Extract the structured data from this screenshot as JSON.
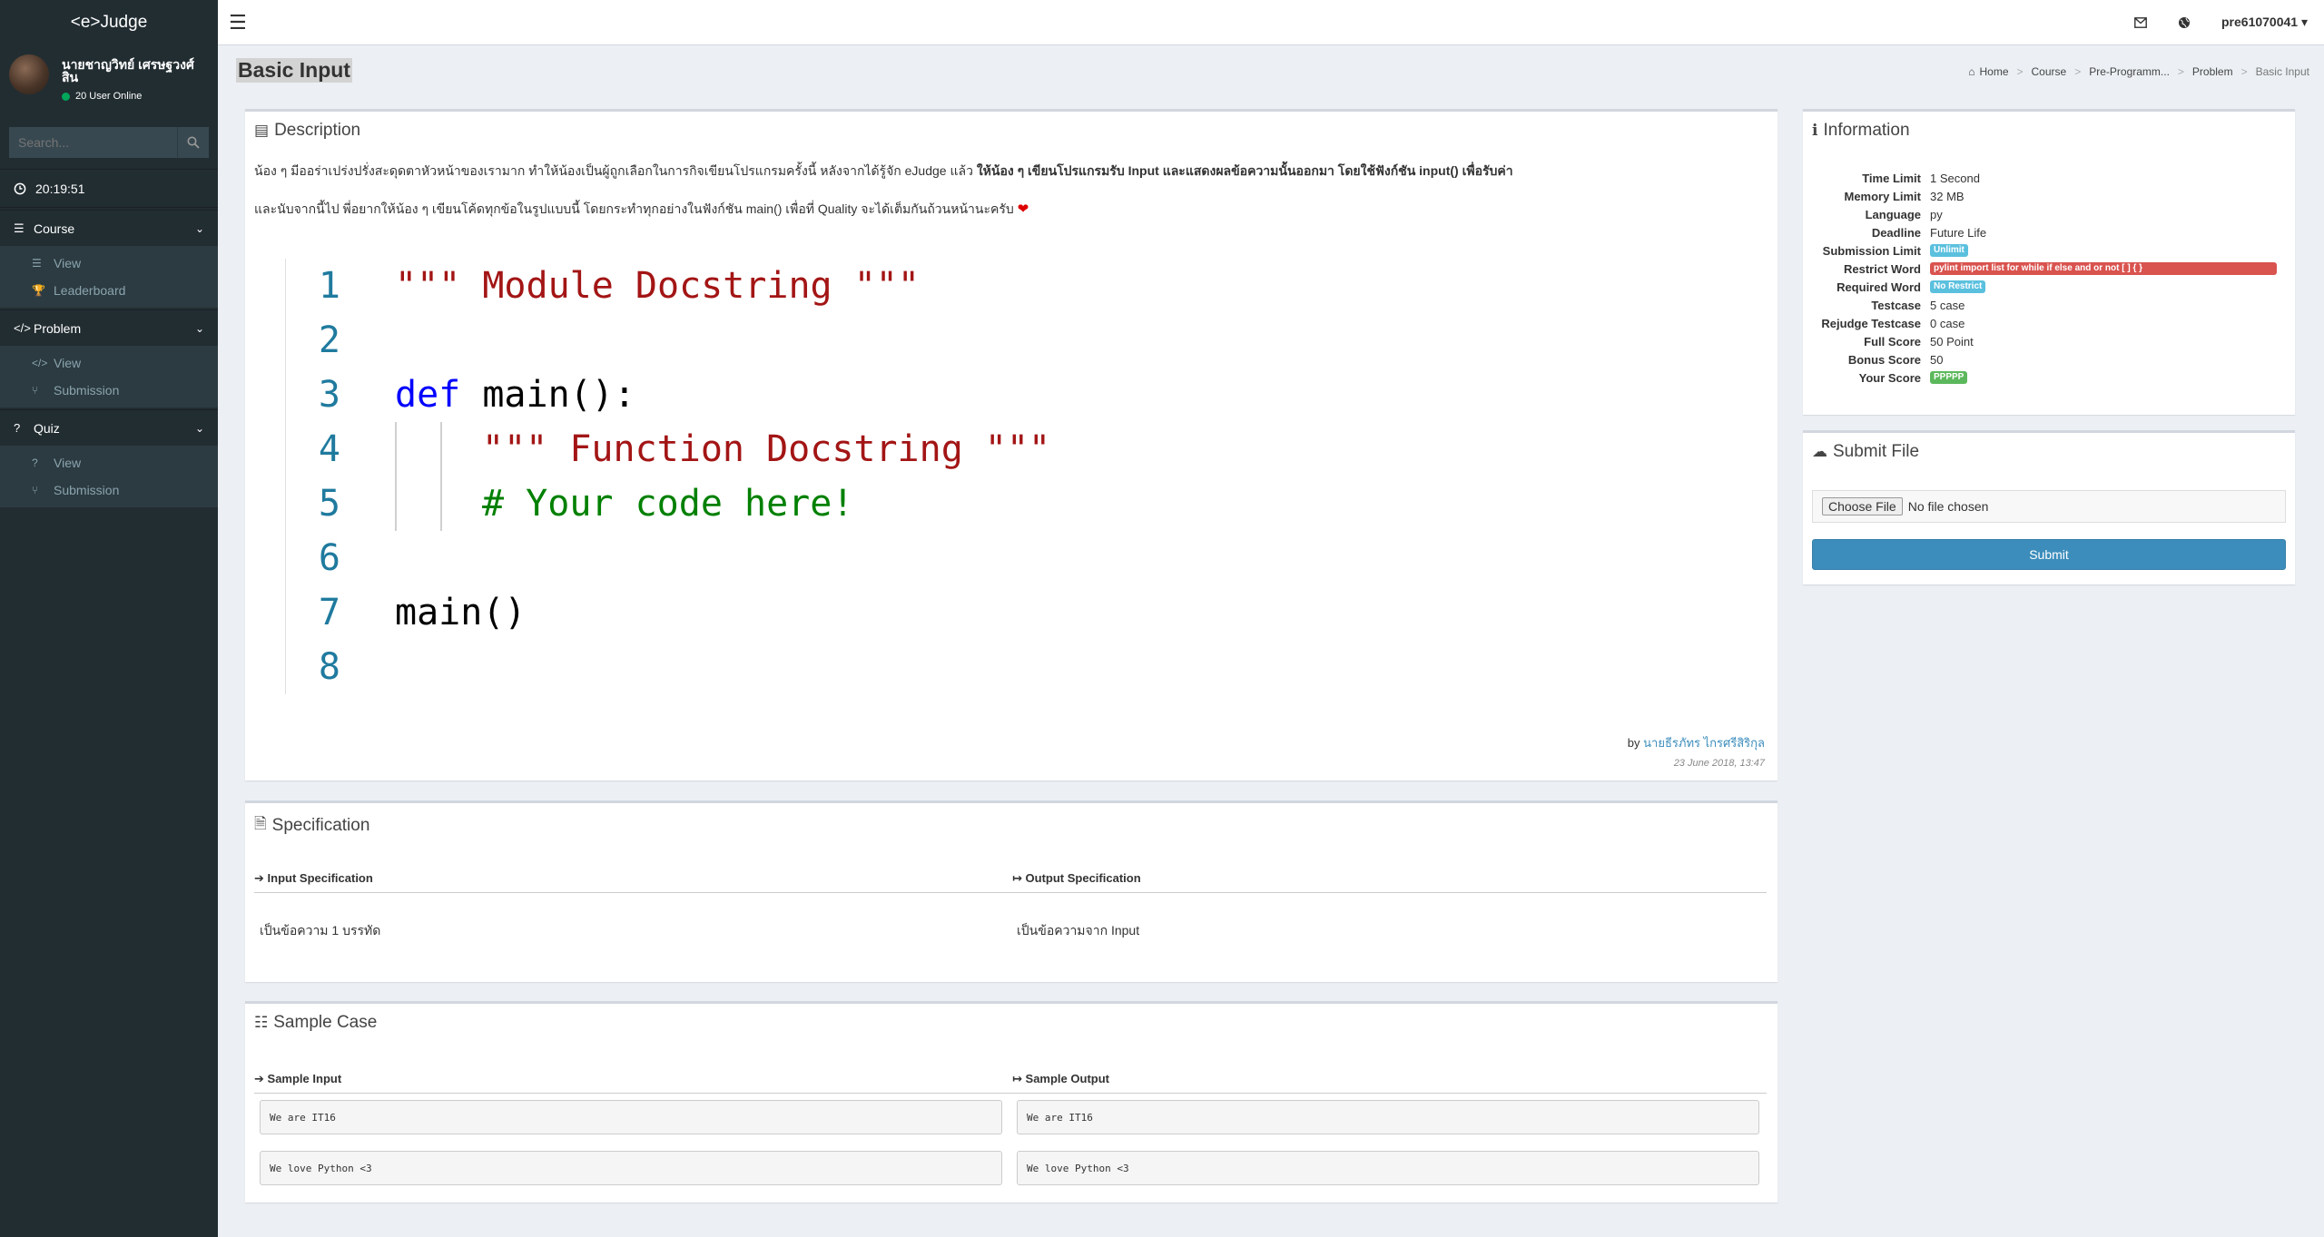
{
  "app": {
    "logo": "<e>Judge"
  },
  "user": {
    "name": "นายชาญวิทย์ เศรษฐวงศ์สิน",
    "online": "20 User Online"
  },
  "search": {
    "placeholder": "Search..."
  },
  "clock": "20:19:51",
  "sidebar": {
    "sections": [
      {
        "label": "Course",
        "icon": "list-icon",
        "items": [
          {
            "label": "View",
            "icon": "list-icon"
          },
          {
            "label": "Leaderboard",
            "icon": "trophy-icon"
          }
        ]
      },
      {
        "label": "Problem",
        "icon": "code-icon",
        "items": [
          {
            "label": "View",
            "icon": "code-icon"
          },
          {
            "label": "Submission",
            "icon": "branch-icon"
          }
        ]
      },
      {
        "label": "Quiz",
        "icon": "question-icon",
        "items": [
          {
            "label": "View",
            "icon": "question-icon"
          },
          {
            "label": "Submission",
            "icon": "branch-icon"
          }
        ]
      }
    ]
  },
  "topbar": {
    "username": "pre61070041"
  },
  "page": {
    "title": "Basic Input"
  },
  "breadcrumb": [
    "Home",
    "Course",
    "Pre-Programm...",
    "Problem",
    "Basic Input"
  ],
  "description": {
    "title": "Description",
    "line1_normal": "น้อง ๆ มีออร่าเปร่งปรั่งสะดุดตาหัวหน้าของเรามาก ทำให้น้องเป็นผู้ถูกเลือกในการกิจเขียนโปรแกรมครั้งนี้ หลังจากได้รู้จัก eJudge แล้ว ",
    "line1_bold": "ให้น้อง ๆ เขียนโปรแกรมรับ Input และแสดงผลข้อความนั้นออกมา โดยใช้ฟังก์ชัน input() เพื่อรับค่า",
    "line2": "และนับจากนี้ไป พี่อยากให้น้อง ๆ เขียนโค้ดทุกข้อในรูปแบบนี้ โดยกระทำทุกอย่างในฟังก์ชัน main() เพื่อที่ Quality จะได้เต็มกันถ้วนหน้านะครับ",
    "code": {
      "line_numbers": [
        "1",
        "2",
        "3",
        "4",
        "5",
        "6",
        "7",
        "8"
      ],
      "l1": "\"\"\" Module Docstring \"\"\"",
      "l3_kw": "def",
      "l3_rest": " main():",
      "l4": "\"\"\" Function Docstring \"\"\"",
      "l5": "# Your code here!",
      "l7": "main()"
    },
    "by_prefix": "by",
    "author": "นายธีรภัทร ไกรศรีสิริกุล",
    "date": "23 June 2018, 13:47"
  },
  "specification": {
    "title": "Specification",
    "input_title": "Input Specification",
    "output_title": "Output Specification",
    "input_value": "เป็นข้อความ 1 บรรทัด",
    "output_value": "เป็นข้อความจาก Input"
  },
  "sample": {
    "title": "Sample Case",
    "input_title": "Sample Input",
    "output_title": "Sample Output",
    "inputs": [
      "We are IT16",
      "We love Python <3"
    ],
    "outputs": [
      "We are IT16",
      "We love Python <3"
    ]
  },
  "information": {
    "title": "Information",
    "rows": [
      {
        "label": "Time Limit",
        "value": "1 Second"
      },
      {
        "label": "Memory Limit",
        "value": "32 MB"
      },
      {
        "label": "Language",
        "value": "py"
      },
      {
        "label": "Deadline",
        "value": "Future Life"
      },
      {
        "label": "Submission Limit",
        "value": "Unlimit",
        "badge_color": "#5bc0de"
      },
      {
        "label": "Restrict Word",
        "value": "pylint import list for while if else and or not [ ] { }",
        "badge_color": "#d9534f"
      },
      {
        "label": "Required Word",
        "value": "No Restrict",
        "badge_color": "#5bc0de"
      },
      {
        "label": "Testcase",
        "value": "5 case"
      },
      {
        "label": "Rejudge Testcase",
        "value": "0 case"
      },
      {
        "label": "Full Score",
        "value": "50 Point"
      },
      {
        "label": "Bonus Score",
        "value": "50"
      },
      {
        "label": "Your Score",
        "value": "PPPPP",
        "badge_color": "#5cb85c"
      }
    ]
  },
  "submit_file": {
    "title": "Submit File",
    "choose_label": "Choose File",
    "no_file": "No file chosen",
    "submit_label": "Submit"
  }
}
